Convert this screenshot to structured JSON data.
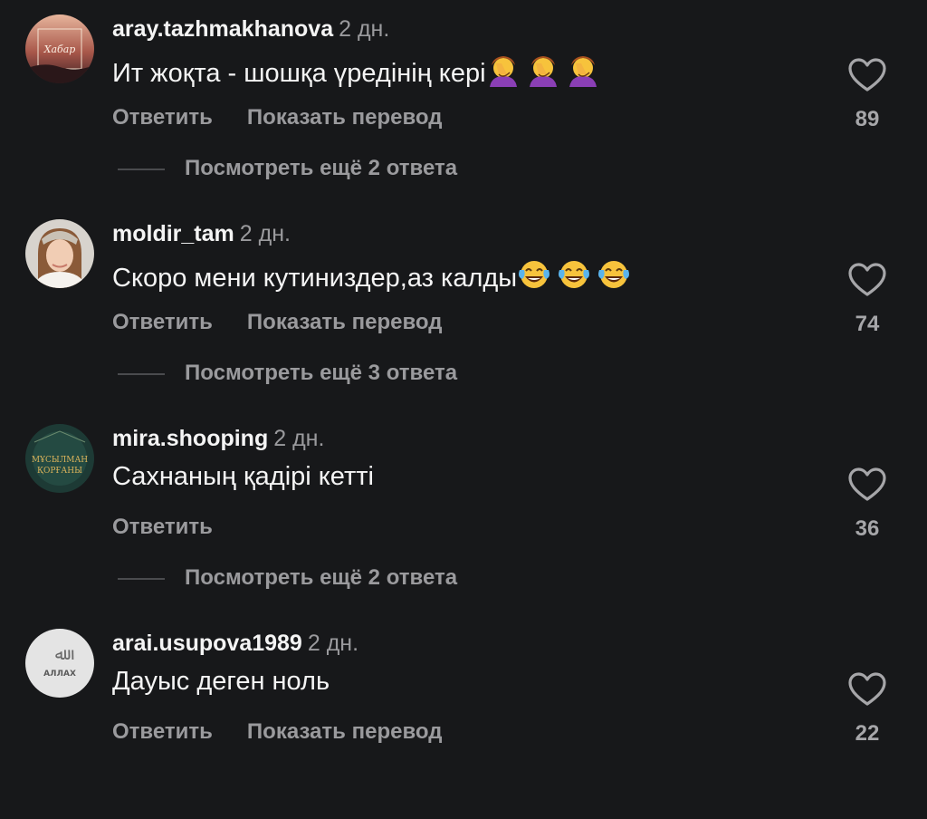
{
  "comments": [
    {
      "username": "aray.tazhmakhanova",
      "time": "2 дн.",
      "text": "Ит жоқта - шошқа үредінің кері",
      "emoji": "facepalm",
      "emoji_count": 3,
      "reply_label": "Ответить",
      "translate_label": "Показать перевод",
      "likes": "89",
      "replies_label": "Посмотреть ещё 2 ответа",
      "avatar_text": "Хабар"
    },
    {
      "username": "moldir_tam",
      "time": "2 дн.",
      "text": "Скоро мени кутиниздер,аз калды",
      "emoji": "tears-of-joy",
      "emoji_count": 3,
      "reply_label": "Ответить",
      "translate_label": "Показать перевод",
      "likes": "74",
      "replies_label": "Посмотреть ещё 3 ответа"
    },
    {
      "username": "mira.shooping",
      "time": "2 дн.",
      "text": "Сахнаның қадірі кетті",
      "reply_label": "Ответить",
      "likes": "36",
      "replies_label": "Посмотреть ещё 2 ответа",
      "avatar_text_1": "МҰСЫЛМАН",
      "avatar_text_2": "ҚОРҒАНЫ"
    },
    {
      "username": "arai.usupova1989",
      "time": "2 дн.",
      "text": "Дауыс деген ноль",
      "reply_label": "Ответить",
      "translate_label": "Показать перевод",
      "likes": "22",
      "avatar_text_1": "ﷲ",
      "avatar_text_2": "АЛЛАХ"
    }
  ],
  "colors": {
    "background": "#17181a",
    "primary_text": "#f4f4f4",
    "secondary_text": "#9a9a9d"
  },
  "icons": {
    "like": "heart-outline-icon",
    "facepalm": "facepalm-emoji",
    "laugh": "tears-of-joy-emoji"
  }
}
